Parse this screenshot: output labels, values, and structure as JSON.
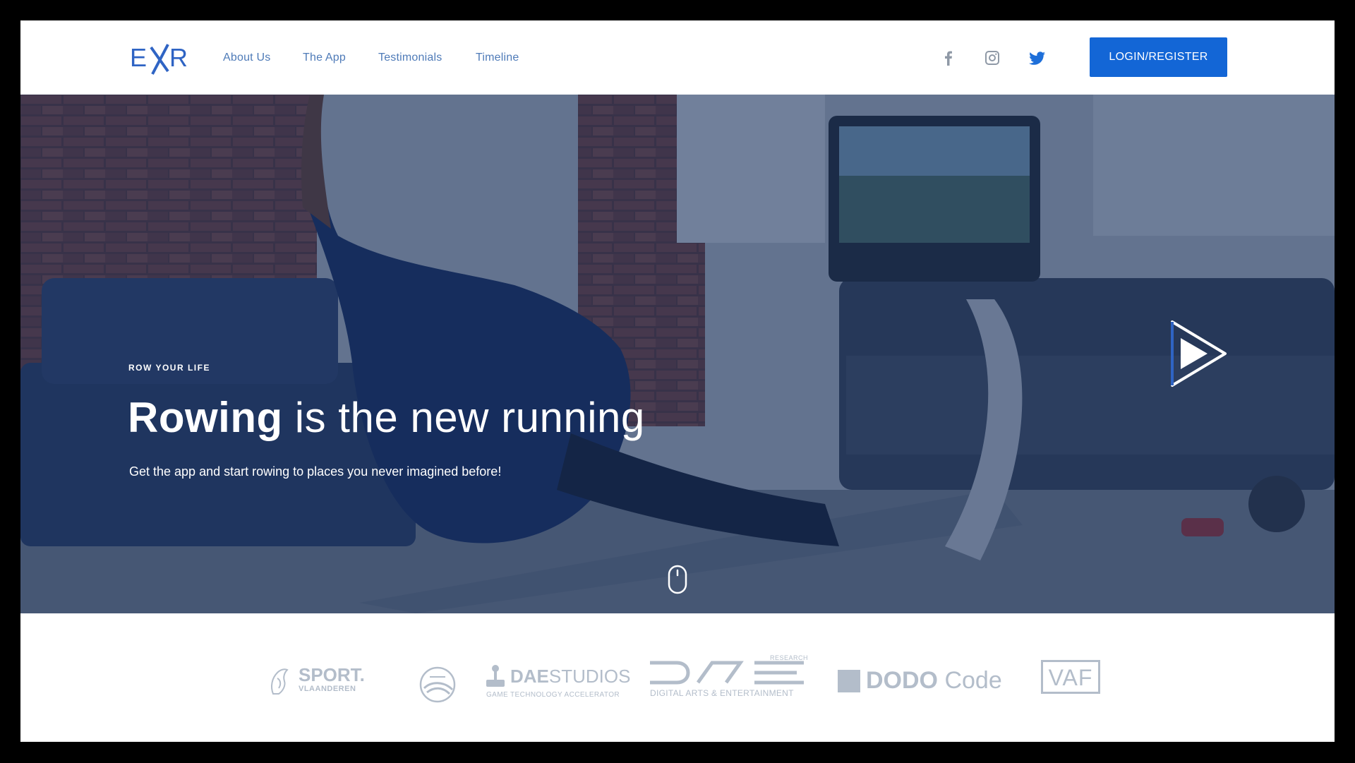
{
  "brand": {
    "logo_text_left": "E",
    "logo_text_x": "X",
    "logo_text_right": "R"
  },
  "nav": {
    "links": [
      {
        "label": "About Us"
      },
      {
        "label": "The App"
      },
      {
        "label": "Testimonials"
      },
      {
        "label": "Timeline"
      }
    ],
    "social_icons": [
      "facebook-icon",
      "instagram-icon",
      "twitter-icon"
    ],
    "login_label": "LOGIN/REGISTER"
  },
  "hero": {
    "eyebrow": "ROW YOUR LIFE",
    "headline_strong": "Rowing",
    "headline_rest": " is the new running",
    "subtext": "Get the app and start rowing to places you never imagined before!",
    "play_icon": "play-icon",
    "scroll_icon": "mouse-scroll-icon"
  },
  "partners": {
    "sport_line1": "SPORT.",
    "sport_line2": "VLAANDEREN",
    "dae_studios_bold": "DAE",
    "dae_studios_rest": "STUDIOS",
    "dae_studios_sub": "GAME TECHNOLOGY ACCELERATOR",
    "dae_research_mark": "DAE",
    "dae_research_top": "RESEARCH",
    "dae_research_sub": "DIGITAL ARTS & ENTERTAINMENT",
    "dodo_bold": "DODO",
    "dodo_rest": " Code",
    "vaf": "VAF"
  },
  "colors": {
    "accent": "#1366d6",
    "nav_link": "#4f7bb8",
    "partner_grey": "#b3bdca",
    "hero_overlay": "#0f2855"
  }
}
